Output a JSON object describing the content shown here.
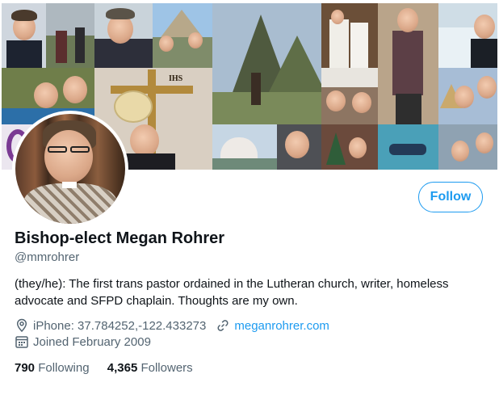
{
  "banner": {
    "alt_description": "profile-banner-collage",
    "sign_text": "IHS"
  },
  "profile": {
    "display_name": "Bishop-elect Megan Rohrer",
    "handle": "@mmrohrer",
    "bio": "(they/he): The first trans pastor ordained in the Lutheran church, writer, homeless advocate and SFPD chaplain. Thoughts are my own.",
    "location": "iPhone: 37.784252,-122.433273",
    "website": "meganrohrer.com",
    "joined": "Joined February 2009",
    "following_count": "790",
    "following_label": "Following",
    "followers_count": "4,365",
    "followers_label": "Followers"
  },
  "actions": {
    "follow_label": "Follow"
  },
  "icons": {
    "location": "location-pin-icon",
    "link": "link-icon",
    "joined": "calendar-icon"
  },
  "colors": {
    "accent": "#1d9bf0",
    "text_primary": "#0f1419",
    "text_secondary": "#536471"
  }
}
